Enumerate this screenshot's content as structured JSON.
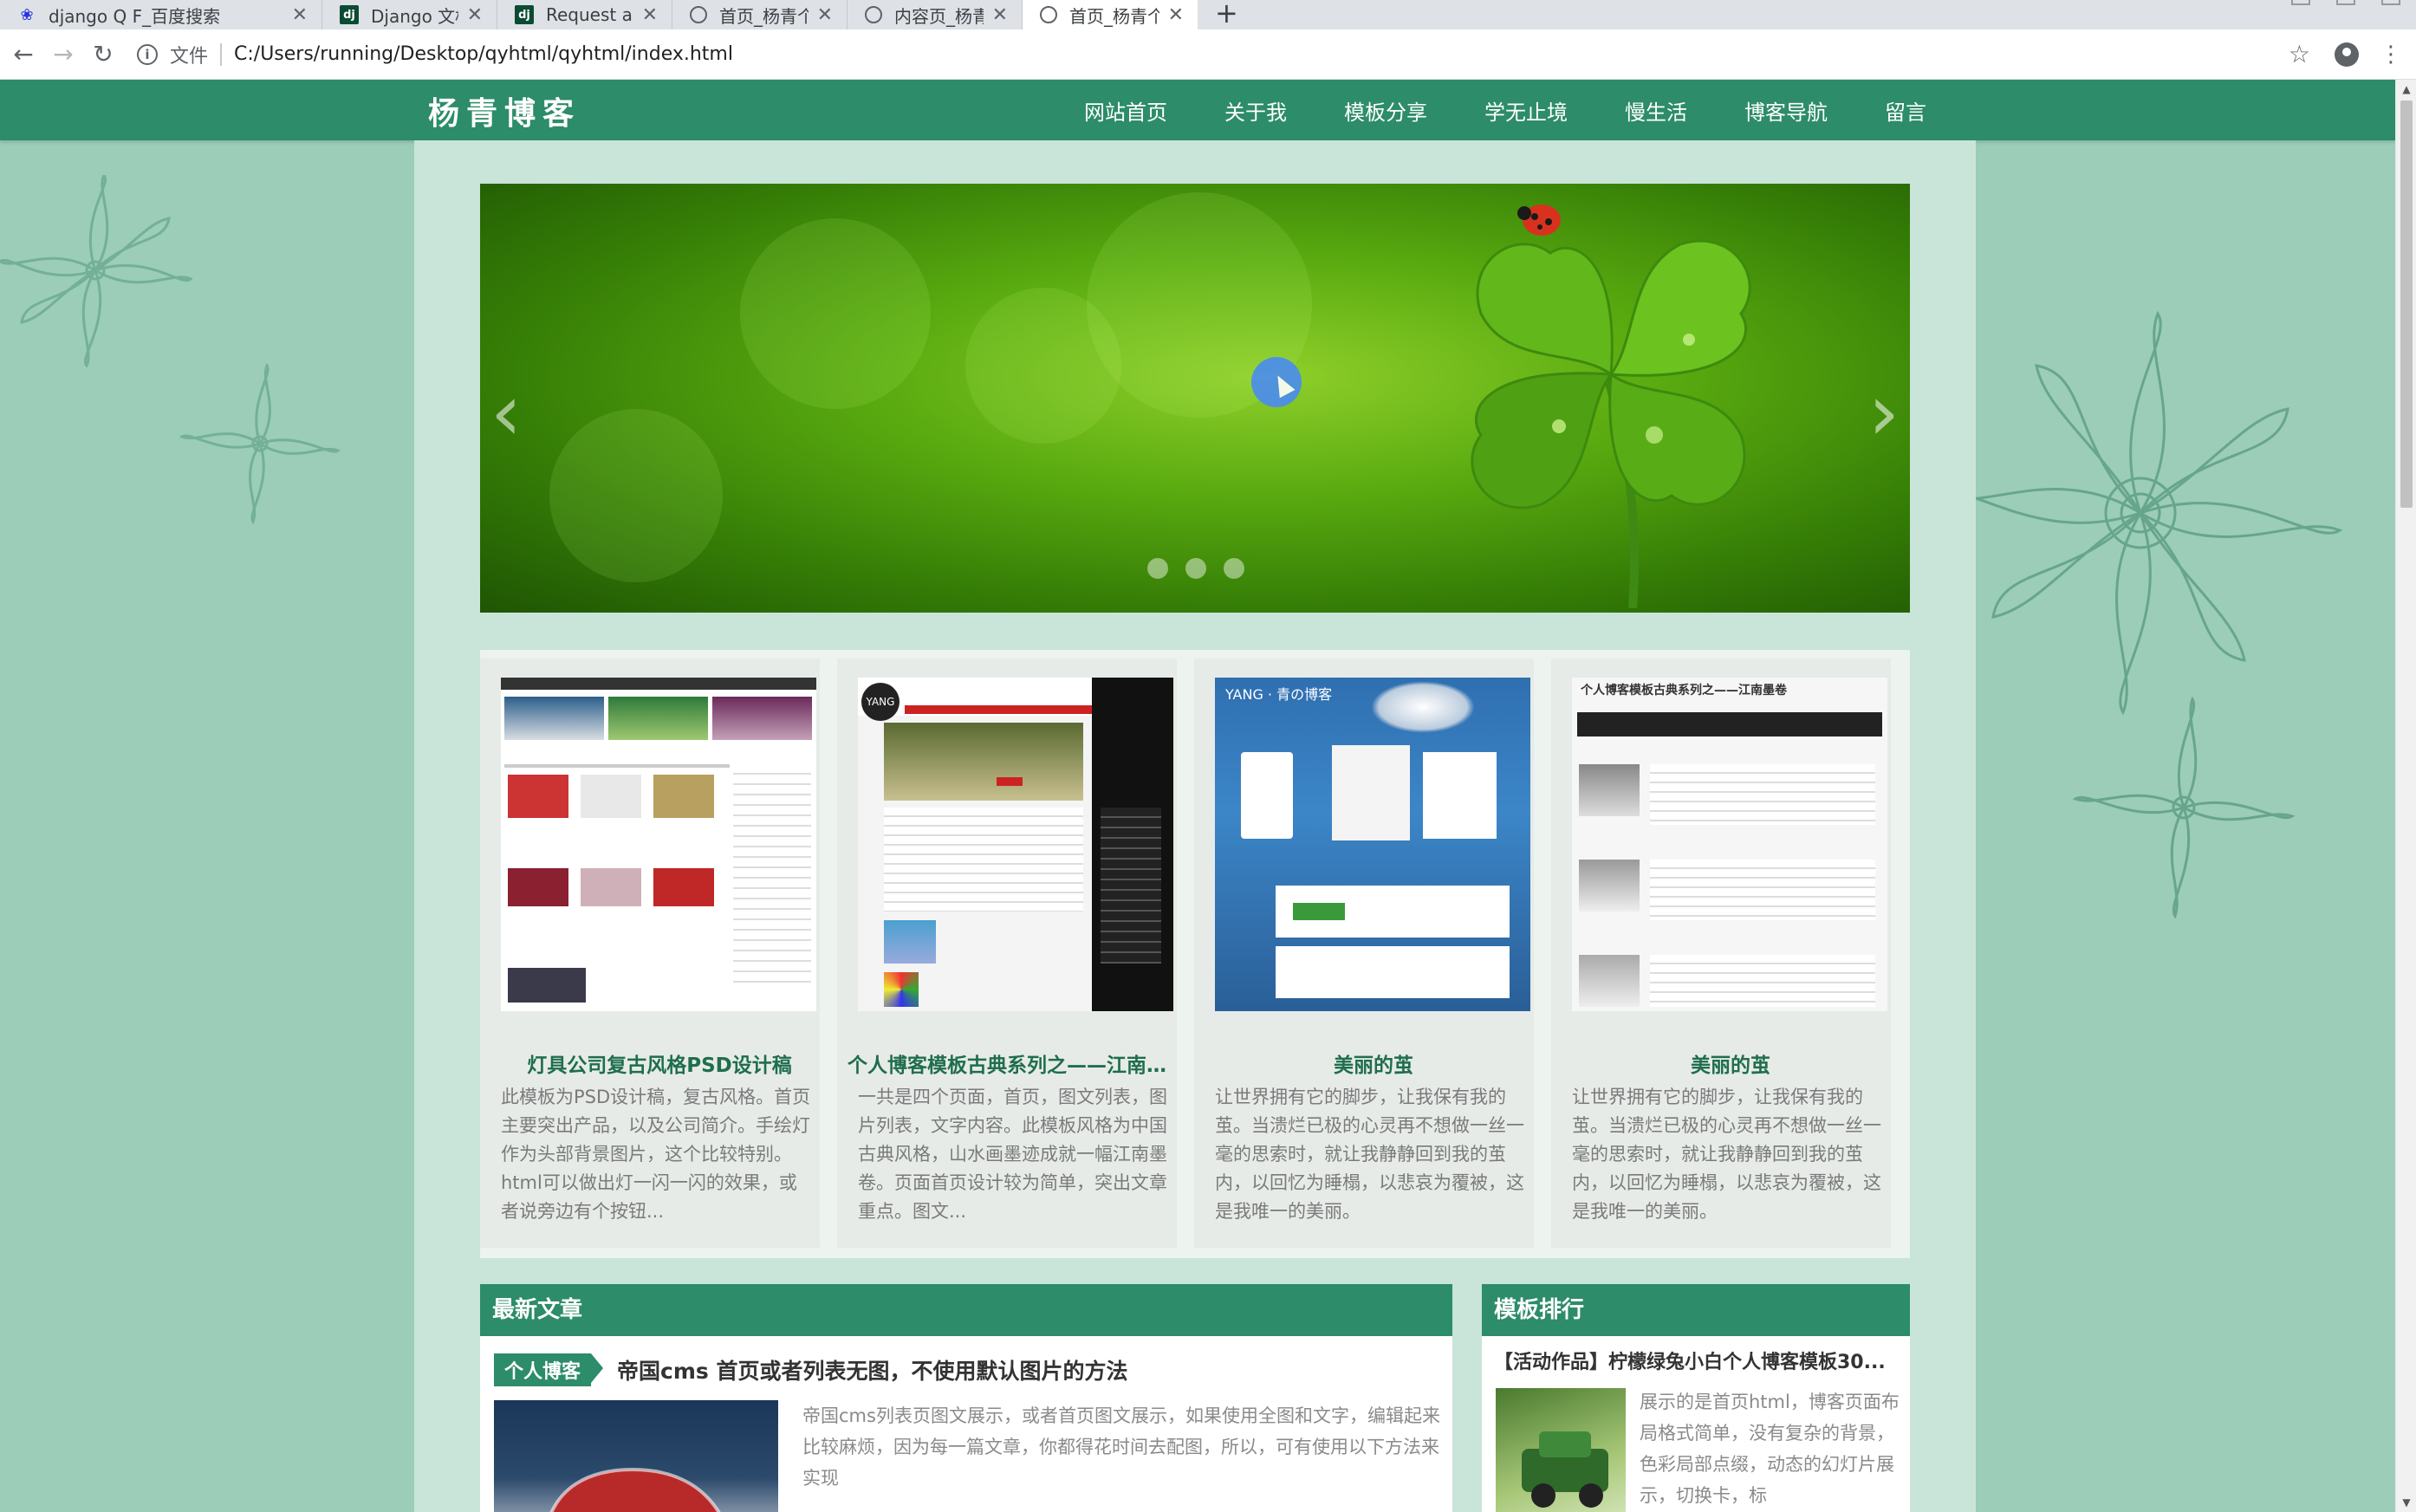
{
  "browser": {
    "tabs": [
      {
        "title": "django Q F_百度搜索",
        "icon": "baidu-paw-icon",
        "active": false
      },
      {
        "title": "Django 文档 | Django 文档 | Dj",
        "icon": "django-icon",
        "active": false
      },
      {
        "title": "Request and response objects",
        "icon": "django-icon",
        "active": false
      },
      {
        "title": "首页_杨青个人博客 - 一个站在w",
        "icon": "globe-icon",
        "active": false
      },
      {
        "title": "内容页_杨青个人博客 - 一个站在",
        "icon": "globe-icon",
        "active": false
      },
      {
        "title": "首页_杨青个人博客 - 一个站在w",
        "icon": "globe-icon",
        "active": true
      }
    ],
    "new_tab": "+",
    "close_glyph": "✕",
    "url_scheme_label": "文件",
    "url": "C:/Users/running/Desktop/qyhtml/qyhtml/index.html"
  },
  "site": {
    "logo": "杨青博客",
    "nav": [
      "网站首页",
      "关于我",
      "模板分享",
      "学无止境",
      "慢生活",
      "博客导航",
      "留言"
    ],
    "slider": {
      "prev": "‹",
      "next": "›",
      "dots": 3,
      "active_dot": 0
    },
    "cards": [
      {
        "title": "灯具公司复古风格PSD设计稿",
        "desc": "此模板为PSD设计稿，复古风格。首页主要突出产品，以及公司简介。手绘灯作为头部背景图片，这个比较特别。html可以做出灯一闪一闪的效果，或者说旁边有个按钮..."
      },
      {
        "title": "个人博客模板古典系列之——江南墨...",
        "desc": "一共是四个页面，首页，图文列表，图片列表，文字内容。此模板风格为中国古典风格，山水画墨迹成就一幅江南墨卷。页面首页设计较为简单，突出文章重点。图文..."
      },
      {
        "title": "美丽的茧",
        "desc": "让世界拥有它的脚步，让我保有我的茧。当溃烂已极的心灵再不想做一丝一毫的思索时，就让我静静回到我的茧内，以回忆为睡榻，以悲哀为覆被，这是我唯一的美丽。"
      },
      {
        "title": "美丽的茧",
        "desc": "让世界拥有它的脚步，让我保有我的茧。当溃烂已极的心灵再不想做一丝一毫的思索时，就让我静静回到我的茧内，以回忆为睡榻，以悲哀为覆被，这是我唯一的美丽。"
      }
    ],
    "latest": {
      "heading": "最新文章",
      "tag": "个人博客",
      "title": "帝国cms 首页或者列表无图，不使用默认图片的方法",
      "desc": "帝国cms列表页图文展示，或者首页图文展示，如果使用全图和文字，编辑起来比较麻烦，因为每一篇文章，你都得花时间去配图，所以，可有使用以下方法来实现"
    },
    "rank": {
      "heading": "模板排行",
      "top_title": "【活动作品】柠檬绿兔小白个人博客模板30...",
      "desc": "展示的是首页html，博客页面布局格式简单，没有复杂的背景，色彩局部点缀，动态的幻灯片展示，切换卡，标"
    },
    "thumb_texts": {
      "t2_logo": "YANG",
      "t3_header": "YANG · 青の博客",
      "t4_header": "个人博客模板古典系列之——江南墨卷"
    }
  },
  "colors": {
    "brand": "#2d8c6a",
    "page_bg": "#9bcdb8",
    "content_bg": "#c9e4d8"
  }
}
